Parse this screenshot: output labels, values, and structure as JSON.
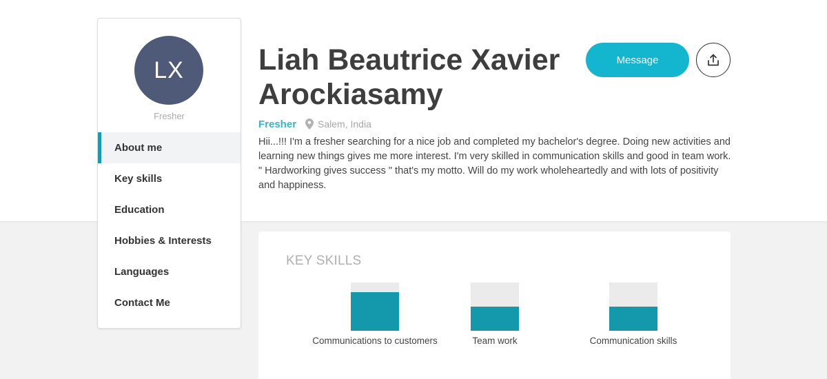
{
  "sidebar": {
    "avatar_initials": "LX",
    "role": "Fresher",
    "items": [
      {
        "label": "About me",
        "active": true
      },
      {
        "label": "Key skills"
      },
      {
        "label": "Education"
      },
      {
        "label": "Hobbies & Interests"
      },
      {
        "label": "Languages"
      },
      {
        "label": "Contact Me"
      }
    ]
  },
  "profile": {
    "name": "Liah Beautrice Xavier Arockiasamy",
    "role": "Fresher",
    "location": "Salem, India",
    "about": "Hii...!!! I'm a fresher searching for a nice job and completed my bachelor's degree. Doing new activities and learning new things gives me more interest. I'm very skilled in communication skills and good in team work. \" Hardworking gives success \" that's my motto. Will do my work wholeheartedly and with lots of positivity and happiness."
  },
  "actions": {
    "message_label": "Message",
    "share_icon": "share-icon"
  },
  "skills": {
    "title": "KEY SKILLS",
    "items": [
      {
        "label": "Communications to customers",
        "level": 0.8
      },
      {
        "label": "Team work",
        "level": 0.5
      },
      {
        "label": "Communication skills",
        "level": 0.5
      }
    ]
  },
  "colors": {
    "accent": "#14b5cf",
    "skill_fill": "#1498ab",
    "avatar_bg": "#4f5a78",
    "active_marker": "#1a9aae"
  }
}
